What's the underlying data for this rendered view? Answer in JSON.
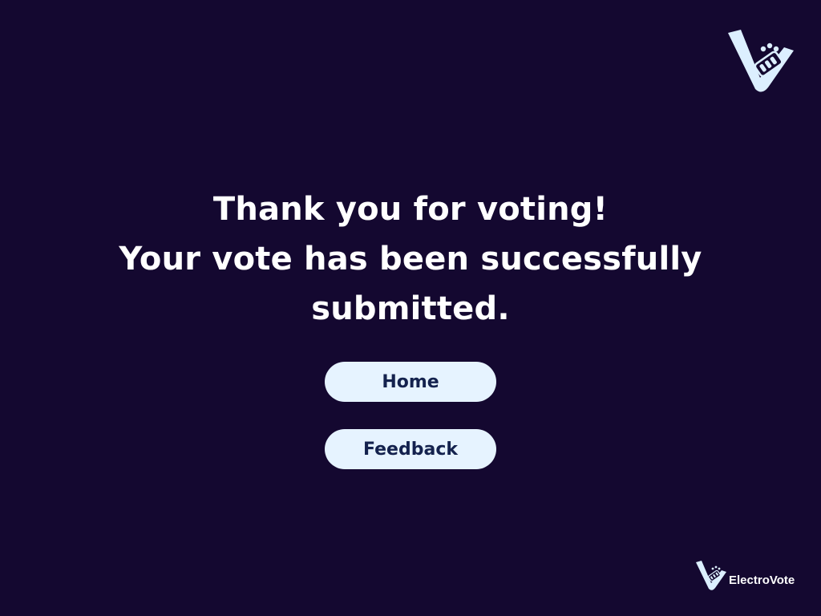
{
  "logo": {
    "icon": "electrovote-ballot-check-icon"
  },
  "message": {
    "line1": "Thank you for voting!",
    "line2": "Your vote has been successfully",
    "line3": "submitted."
  },
  "buttons": {
    "home_label": "Home",
    "feedback_label": "Feedback"
  },
  "brand": {
    "name": "ElectroVote"
  },
  "colors": {
    "background": "#140830",
    "button_bg": "#e6f3ff",
    "button_text": "#14224e",
    "logo": "#dcefff"
  }
}
